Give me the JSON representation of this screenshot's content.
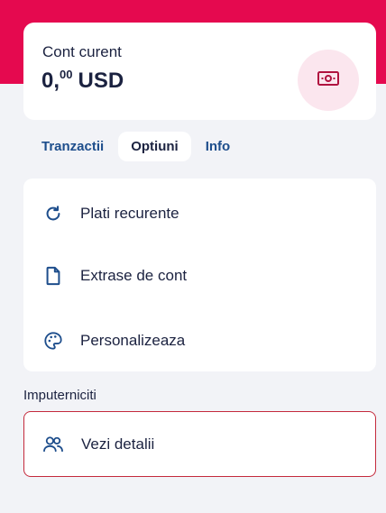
{
  "account": {
    "name": "Cont curent",
    "balance_int": "0,",
    "balance_dec": "00",
    "currency": "USD",
    "icon": "banknote-icon"
  },
  "tabs": [
    {
      "label": "Tranzactii",
      "active": false
    },
    {
      "label": "Optiuni",
      "active": true
    },
    {
      "label": "Info",
      "active": false
    }
  ],
  "options": [
    {
      "label": "Plati recurente",
      "icon": "recurring-icon"
    },
    {
      "label": "Extrase de cont",
      "icon": "document-icon"
    },
    {
      "label": "Personalizeaza",
      "icon": "palette-icon"
    }
  ],
  "delegates": {
    "title": "Imputerniciti",
    "details_label": "Vezi detalii",
    "icon": "users-icon"
  },
  "colors": {
    "brand": "#e5094f",
    "accent_soft": "#fbe6ee",
    "icon_blue": "#1e4e8c",
    "text_dark": "#1b2240",
    "highlight_border": "#c42a3c",
    "background": "#f2f3f7"
  }
}
